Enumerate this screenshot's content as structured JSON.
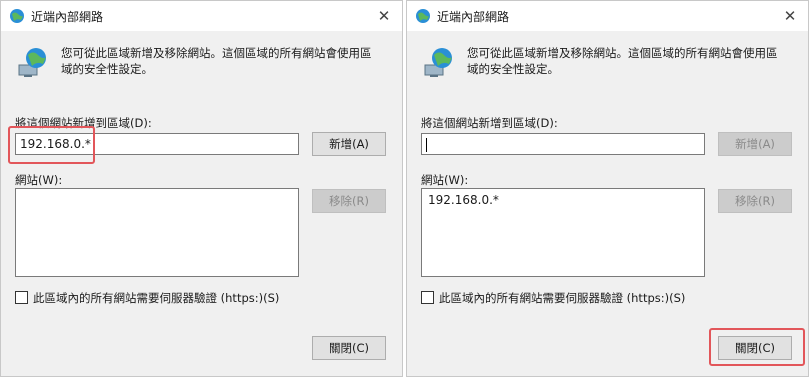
{
  "left": {
    "title": "近端內部網路",
    "description": "您可從此區域新增及移除網站。這個區域的所有網站會使用區域的安全性設定。",
    "add_label": "將這個網站新增到區域(D):",
    "add_value": "192.168.0.*",
    "add_button": "新增(A)",
    "sites_label": "網站(W):",
    "sites": [],
    "remove_button": "移除(R)",
    "https_label": "此區域內的所有網站需要伺服器驗證 (https:)(S)",
    "close_button": "關閉(C)"
  },
  "right": {
    "title": "近端內部網路",
    "description": "您可從此區域新增及移除網站。這個區域的所有網站會使用區域的安全性設定。",
    "add_label": "將這個網站新增到區域(D):",
    "add_value": "",
    "add_button": "新增(A)",
    "sites_label": "網站(W):",
    "sites": [
      "192.168.0.*"
    ],
    "remove_button": "移除(R)",
    "https_label": "此區域內的所有網站需要伺服器驗證 (https:)(S)",
    "close_button": "關閉(C)"
  },
  "colors": {
    "highlight": "#e2565a"
  }
}
